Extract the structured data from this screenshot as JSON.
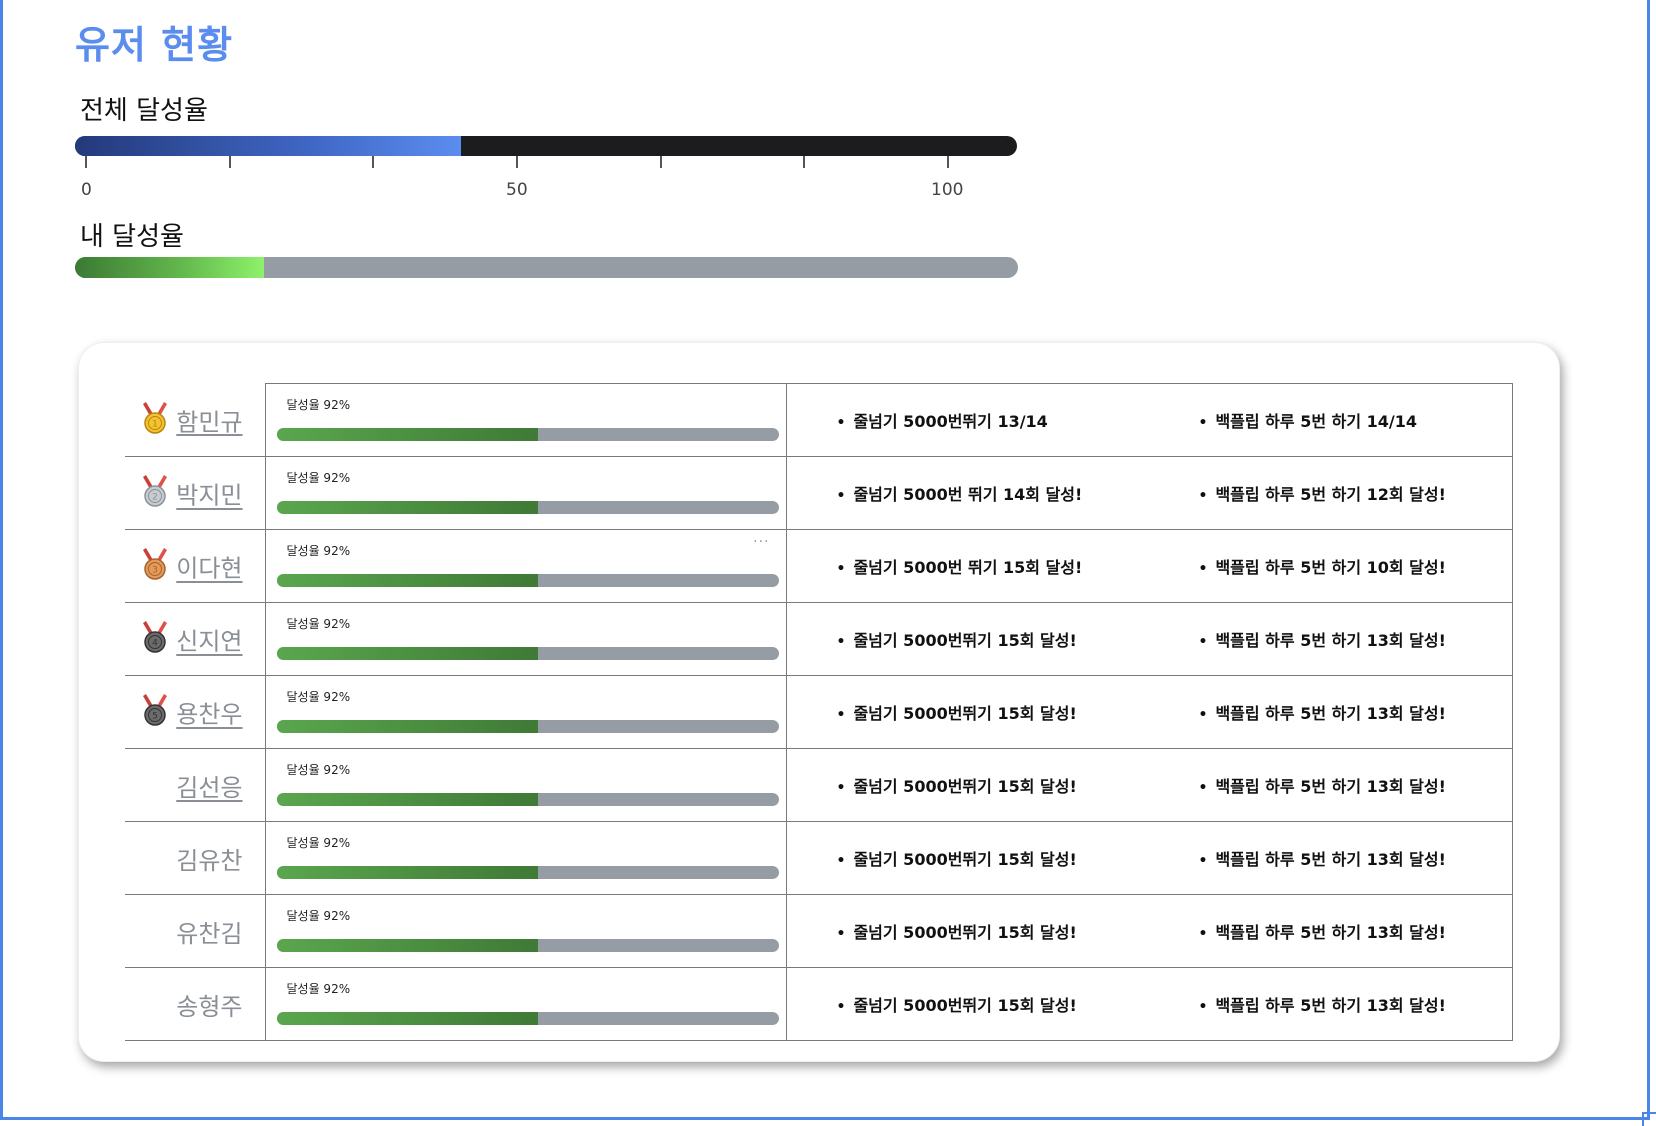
{
  "page": {
    "title": "유저 현황"
  },
  "overall": {
    "label": "전체 달성율",
    "value": 41,
    "axis": {
      "min": 0,
      "max": 100,
      "tick_labels": [
        "0",
        "50",
        "100"
      ]
    }
  },
  "mine": {
    "label": "내 달성율",
    "value": 20
  },
  "colors": {
    "accent": "#5b8def",
    "overall_track": "#1c1c1e",
    "my_fill": "#62b64c",
    "track_gray": "#959ca3"
  },
  "ranking": {
    "rows": [
      {
        "rank": 1,
        "medal": "gold-medal-icon",
        "name": "함민규",
        "link": true,
        "rate_label": "달성율 92%",
        "rate": 52,
        "goals": [
          "줄넘기 5000번뛰기 13/14",
          "백플립 하루 5번 하기 14/14"
        ]
      },
      {
        "rank": 2,
        "medal": "silver-medal-icon",
        "name": "박지민",
        "link": true,
        "rate_label": "달성율 92%",
        "rate": 52,
        "goals": [
          "줄넘기 5000번 뛰기 14회 달성!",
          "백플립 하루 5번 하기 12회 달성!"
        ]
      },
      {
        "rank": 3,
        "medal": "bronze-medal-icon",
        "name": "이다현",
        "link": true,
        "rate_label": "달성율 92%",
        "rate": 52,
        "more": "···",
        "goals": [
          "줄넘기 5000번  뛰기 15회 달성!",
          "백플립 하루 5번 하기 10회 달성!"
        ]
      },
      {
        "rank": 4,
        "medal": "dark-medal-icon",
        "name": "신지연",
        "link": true,
        "rate_label": "달성율 92%",
        "rate": 52,
        "goals": [
          "줄넘기 5000번뛰기 15회 달성!",
          "백플립 하루 5번 하기 13회 달성!"
        ]
      },
      {
        "rank": 5,
        "medal": "dark-medal-icon",
        "name": "용찬우",
        "link": true,
        "rate_label": "달성율 92%",
        "rate": 52,
        "goals": [
          "줄넘기 5000번뛰기 15회 달성!",
          "백플립 하루 5번 하기 13회 달성!"
        ]
      },
      {
        "rank": 6,
        "medal": null,
        "name": "김선응",
        "link": true,
        "rate_label": "달성율 92%",
        "rate": 52,
        "goals": [
          "줄넘기 5000번뛰기 15회 달성!",
          "백플립 하루 5번 하기 13회 달성!"
        ]
      },
      {
        "rank": 7,
        "medal": null,
        "name": "김유찬",
        "link": false,
        "rate_label": "달성율 92%",
        "rate": 52,
        "goals": [
          "줄넘기 5000번뛰기 15회 달성!",
          "백플립 하루 5번 하기 13회 달성!"
        ]
      },
      {
        "rank": 8,
        "medal": null,
        "name": "유찬김",
        "link": false,
        "rate_label": "달성율 92%",
        "rate": 52,
        "goals": [
          "줄넘기 5000번뛰기 15회 달성!",
          "백플립 하루 5번 하기 13회 달성!"
        ]
      },
      {
        "rank": 9,
        "medal": null,
        "name": "송형주",
        "link": false,
        "rate_label": "달성율 92%",
        "rate": 52,
        "goals": [
          "줄넘기 5000번뛰기 15회 달성!",
          "백플립 하루 5번 하기 13회 달성!"
        ]
      }
    ]
  }
}
